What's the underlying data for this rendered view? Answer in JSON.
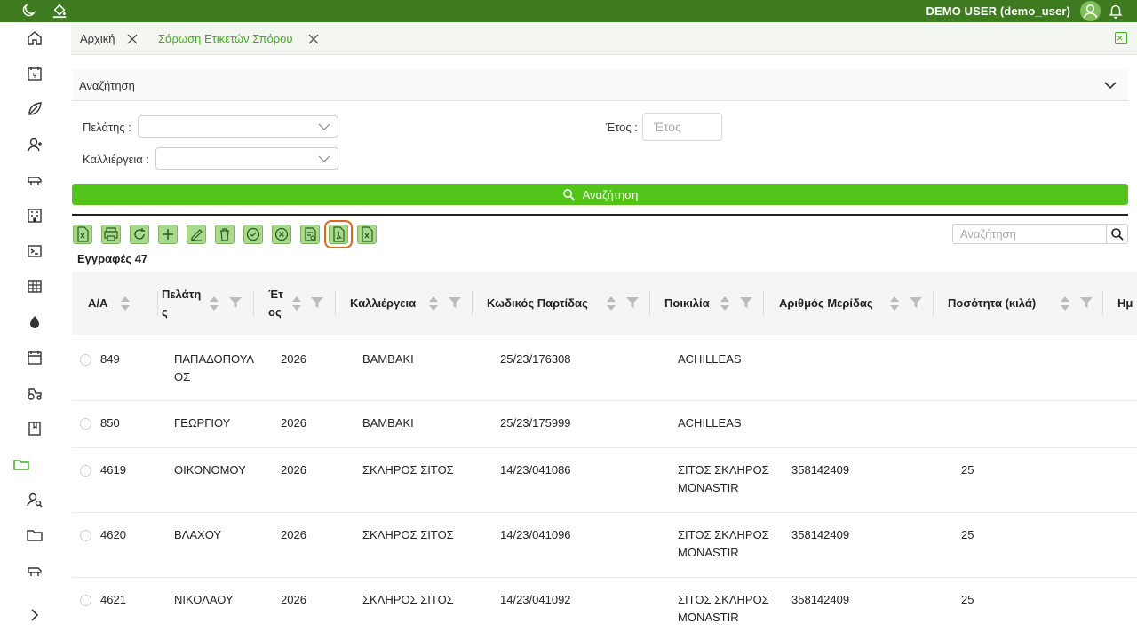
{
  "topbar": {
    "user_label": "DEMO USER (demo_user)",
    "bg_color": "#3e7a1f",
    "icons": [
      "moon-icon",
      "paint-bucket-icon",
      "user-avatar-icon",
      "bell-icon"
    ]
  },
  "sidebar": {
    "items": [
      {
        "icon": "home-icon"
      },
      {
        "icon": "calendar-price-icon"
      },
      {
        "icon": "leaf-icon"
      },
      {
        "icon": "user-icon"
      },
      {
        "icon": "livestock-icon"
      },
      {
        "icon": "building-icon"
      },
      {
        "icon": "terminal-icon"
      },
      {
        "icon": "table-icon"
      },
      {
        "icon": "drop-icon"
      },
      {
        "icon": "calendar-icon"
      },
      {
        "icon": "tractor-icon"
      },
      {
        "icon": "book-icon"
      },
      {
        "icon": "folder-open-icon",
        "active": true
      },
      {
        "icon": "user-search-icon"
      },
      {
        "icon": "folder-icon"
      },
      {
        "icon": "cow-icon"
      },
      {
        "icon": "chevron-right-icon"
      }
    ]
  },
  "tabs": [
    {
      "label": "Αρχική",
      "active": false
    },
    {
      "label": "Σάρωση Ετικετών Σπόρου",
      "active": true
    }
  ],
  "search_panel": {
    "title": "Αναζήτηση",
    "customer_label": "Πελάτης :",
    "crop_label": "Καλλιέργεια :",
    "year_label": "Έτος :",
    "year_placeholder": "Έτος",
    "search_button": "Αναζήτηση",
    "accent_color": "#52c41a"
  },
  "toolbar": {
    "buttons": [
      "export-excel",
      "print",
      "refresh",
      "add",
      "edit",
      "delete",
      "approve",
      "cancel",
      "document-edit",
      "export-pdf",
      "export-excel-2"
    ],
    "selected": "export-pdf",
    "grid_search_placeholder": "Αναζήτηση",
    "records_label": "Εγγραφές 47"
  },
  "table": {
    "columns": [
      {
        "key": "aa",
        "label": "Α/Α"
      },
      {
        "key": "customer",
        "label_lines": [
          "Πελάτη",
          "ς"
        ]
      },
      {
        "key": "year",
        "label_lines": [
          "Έτ",
          "ος"
        ]
      },
      {
        "key": "crop",
        "label": "Καλλιέργεια"
      },
      {
        "key": "batch",
        "label": "Κωδικός Παρτίδας"
      },
      {
        "key": "variety",
        "label": "Ποικιλία"
      },
      {
        "key": "lot",
        "label": "Αριθμός Μερίδας"
      },
      {
        "key": "qty",
        "label": "Ποσότητα (κιλά)"
      },
      {
        "key": "date",
        "label": "Ημ"
      }
    ],
    "rows": [
      {
        "aa": "849",
        "customer": [
          "ΠΑΠΑΔΟΠΟΥΛ",
          "ΟΣ"
        ],
        "year": "2026",
        "crop": "ΒΑΜΒΑΚΙ",
        "batch": "25/23/176308",
        "variety": [
          "ACHILLEAS"
        ],
        "lot": "",
        "qty": ""
      },
      {
        "aa": "850",
        "customer": [
          "ΓΕΩΡΓΙΟΥ"
        ],
        "year": "2026",
        "crop": "ΒΑΜΒΑΚΙ",
        "batch": "25/23/175999",
        "variety": [
          "ACHILLEAS"
        ],
        "lot": "",
        "qty": ""
      },
      {
        "aa": "4619",
        "customer": [
          "ΟΙΚΟΝΟΜΟΥ"
        ],
        "year": "2026",
        "crop": "ΣΚΛΗΡΟΣ ΣΙΤΟΣ",
        "batch": "14/23/041086",
        "variety": [
          "ΣΙΤΟΣ ΣΚΛΗΡΟΣ",
          "MONASTIR"
        ],
        "lot": "358142409",
        "qty": "25"
      },
      {
        "aa": "4620",
        "customer": [
          "ΒΛΑΧΟΥ"
        ],
        "year": "2026",
        "crop": "ΣΚΛΗΡΟΣ ΣΙΤΟΣ",
        "batch": "14/23/041096",
        "variety": [
          "ΣΙΤΟΣ ΣΚΛΗΡΟΣ",
          "MONASTIR"
        ],
        "lot": "358142409",
        "qty": "25"
      },
      {
        "aa": "4621",
        "customer": [
          "ΝΙΚΟΛΑΟΥ"
        ],
        "year": "2026",
        "crop": "ΣΚΛΗΡΟΣ ΣΙΤΟΣ",
        "batch": "14/23/041092",
        "variety": [
          "ΣΙΤΟΣ ΣΚΛΗΡΟΣ",
          "MONASTIR"
        ],
        "lot": "358142409",
        "qty": "25"
      }
    ]
  }
}
